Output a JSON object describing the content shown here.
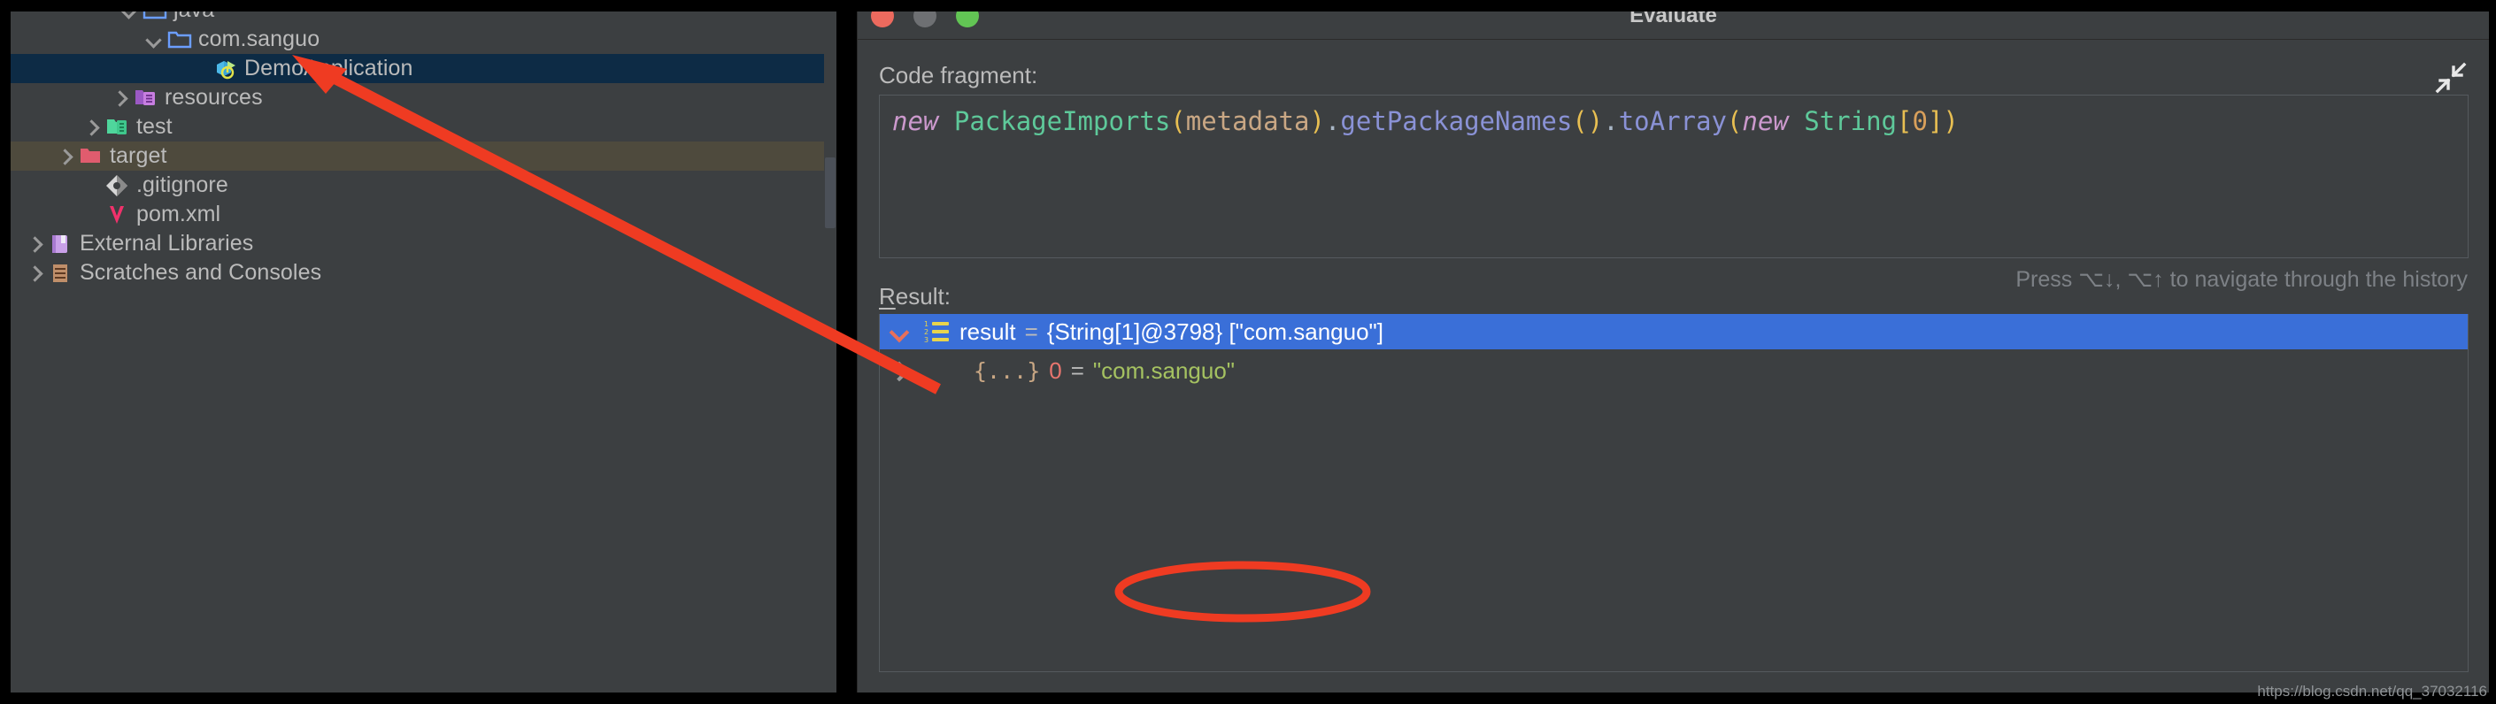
{
  "project_tree": {
    "rows": [
      {
        "label": "java",
        "indent": 120,
        "chevron": "down",
        "icon": "folder-blue-icon",
        "state": "normal"
      },
      {
        "label": "com.sanguo",
        "indent": 148,
        "chevron": "down",
        "icon": "package-blue-icon",
        "state": "normal"
      },
      {
        "label": "DemoApplication",
        "indent": 200,
        "chevron": "none",
        "icon": "spring-boot-run-icon",
        "state": "selected"
      },
      {
        "label": "resources",
        "indent": 110,
        "chevron": "right",
        "icon": "resources-purple-icon",
        "state": "normal"
      },
      {
        "label": "test",
        "indent": 78,
        "chevron": "right",
        "icon": "folder-green-icon",
        "state": "normal"
      },
      {
        "label": "target",
        "indent": 48,
        "chevron": "right",
        "icon": "folder-red-icon",
        "state": "marked"
      },
      {
        "label": ".gitignore",
        "indent": 78,
        "chevron": "none",
        "icon": "git-icon",
        "state": "normal"
      },
      {
        "label": "pom.xml",
        "indent": 78,
        "chevron": "none",
        "icon": "maven-icon",
        "state": "normal"
      },
      {
        "label": "External Libraries",
        "indent": 14,
        "chevron": "right",
        "icon": "library-icon",
        "state": "normal"
      },
      {
        "label": "Scratches and Consoles",
        "indent": 14,
        "chevron": "right",
        "icon": "scratches-icon",
        "state": "normal"
      }
    ],
    "scrollbar": "vertical-scrollbar"
  },
  "dialog": {
    "title": "Evaluate",
    "window_controls": {
      "close": "close-button",
      "minimize": "minimize-button",
      "zoom": "zoom-button"
    },
    "code_label": "Code fragment:",
    "code_fragment": {
      "full_text": "new PackageImports(metadata).getPackageNames().toArray(new String[0])",
      "tokens": [
        {
          "t": "new",
          "c": "kw"
        },
        {
          "t": " ",
          "c": "plain"
        },
        {
          "t": "PackageImports",
          "c": "cls"
        },
        {
          "t": "(",
          "c": "par"
        },
        {
          "t": "metadata",
          "c": "ident"
        },
        {
          "t": ")",
          "c": "par"
        },
        {
          "t": ".",
          "c": "plain"
        },
        {
          "t": "getPackageNames",
          "c": "mth"
        },
        {
          "t": "(",
          "c": "par"
        },
        {
          "t": ")",
          "c": "par"
        },
        {
          "t": ".",
          "c": "plain"
        },
        {
          "t": "toArray",
          "c": "mth"
        },
        {
          "t": "(",
          "c": "par"
        },
        {
          "t": "new",
          "c": "kw"
        },
        {
          "t": " ",
          "c": "plain"
        },
        {
          "t": "String",
          "c": "cls"
        },
        {
          "t": "[",
          "c": "par"
        },
        {
          "t": "0",
          "c": "num"
        },
        {
          "t": "]",
          "c": "par"
        },
        {
          "t": ")",
          "c": "par"
        }
      ]
    },
    "collapse_icon": "collapse-expand-icon",
    "history_hint": "Press ⌥↓, ⌥↑ to navigate through the history",
    "result_label_mnemonic": "R",
    "result_label_rest": "esult:",
    "result_rows": [
      {
        "chevron": "down",
        "icon": "array-list-icon",
        "name": "result",
        "equals": "=",
        "type": "{String[1]@3798}",
        "value": "[\"com.sanguo\"]",
        "selected": true
      },
      {
        "chevron": "right",
        "icon": "braces-icon",
        "brace": "{...}",
        "index": "0",
        "equals": "=",
        "value": "\"com.sanguo\"",
        "selected": false
      }
    ]
  },
  "annotations": {
    "arrow": "red-arrow-annotation",
    "ellipse": "red-ellipse-annotation",
    "color": "#ef3b22"
  },
  "watermark": "https://blog.csdn.net/qq_37032116"
}
